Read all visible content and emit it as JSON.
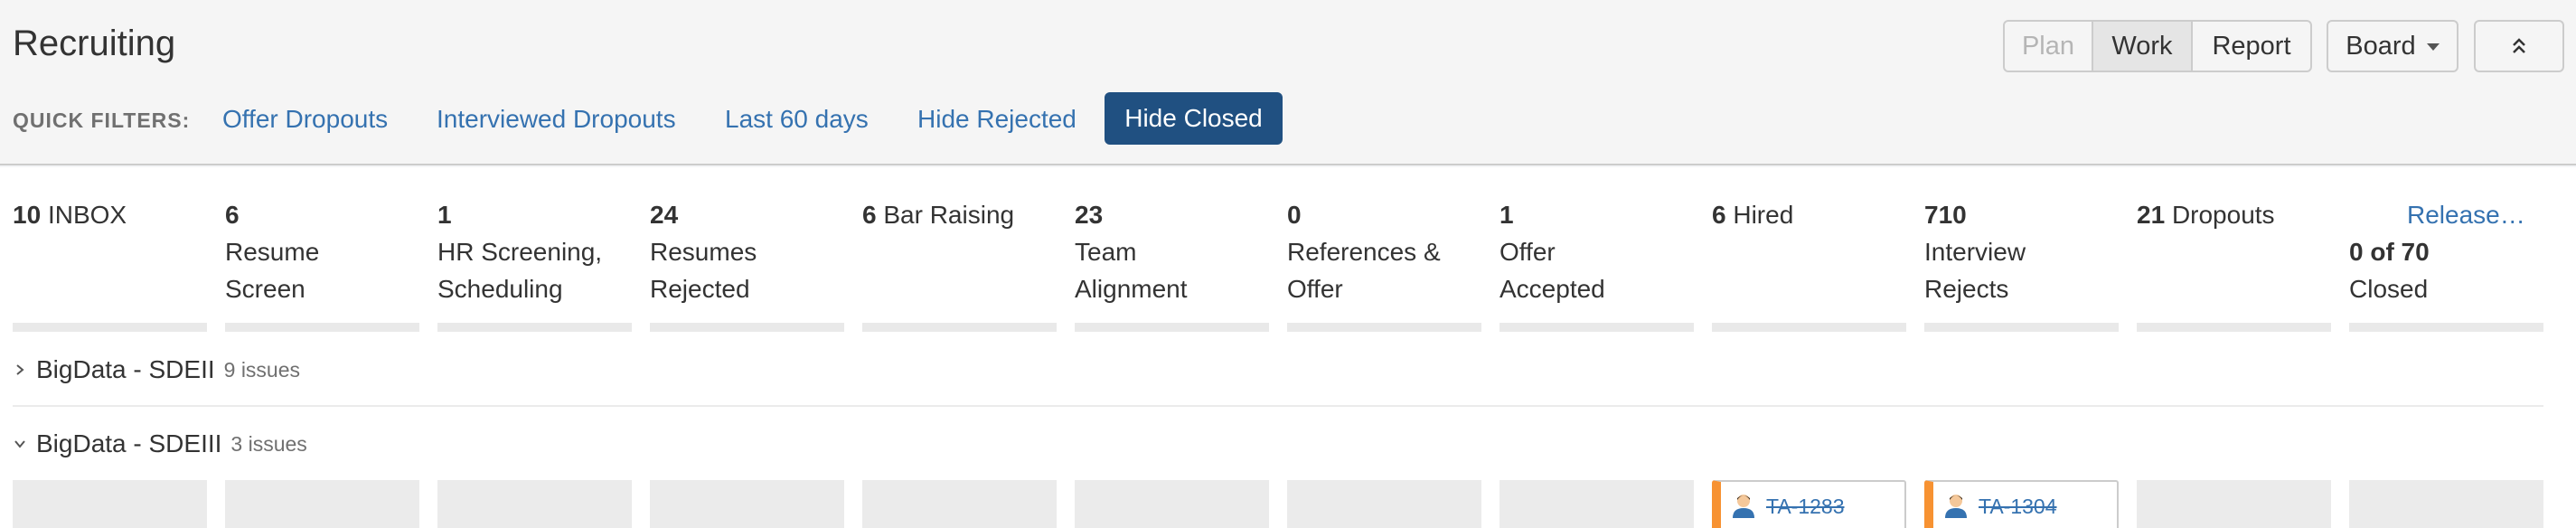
{
  "page": {
    "title": "Recruiting"
  },
  "views": {
    "plan": "Plan",
    "work": "Work",
    "report": "Report"
  },
  "board_menu": {
    "label": "Board"
  },
  "quick_filters": {
    "label": "QUICK FILTERS:",
    "items": [
      "Offer Dropouts",
      "Interviewed Dropouts",
      "Last 60 days",
      "Hide Rejected",
      "Hide Closed"
    ],
    "active": "Hide Closed"
  },
  "columns": [
    {
      "count": "10",
      "name": "INBOX"
    },
    {
      "count": "6",
      "name": "Resume Screen"
    },
    {
      "count": "1",
      "name": "HR Screening, Scheduling"
    },
    {
      "count": "24",
      "name": "Resumes Rejected"
    },
    {
      "count": "6",
      "name": "Bar Raising"
    },
    {
      "count": "23",
      "name": "Team Alignment"
    },
    {
      "count": "0",
      "name": "References & Offer"
    },
    {
      "count": "1",
      "name": "Offer Accepted"
    },
    {
      "count": "6",
      "name": "Hired"
    },
    {
      "count": "710",
      "name": "Interview Rejects"
    },
    {
      "count": "21",
      "name": "Dropouts"
    },
    {
      "release": "Release…",
      "count": "0 of 70",
      "name": "Closed"
    }
  ],
  "swimlanes": [
    {
      "name": "BigData - SDEII",
      "issues": "9 issues",
      "expanded": false
    },
    {
      "name": "BigData - SDEIII",
      "issues": "3 issues",
      "expanded": true
    }
  ],
  "cards": [
    {
      "key": "TA-1283",
      "column": "Hired"
    },
    {
      "key": "TA-1304",
      "column": "Interview Rejects"
    }
  ],
  "colors": {
    "accent": "#205081",
    "link": "#3572b0",
    "card_flag": "#f79232"
  }
}
